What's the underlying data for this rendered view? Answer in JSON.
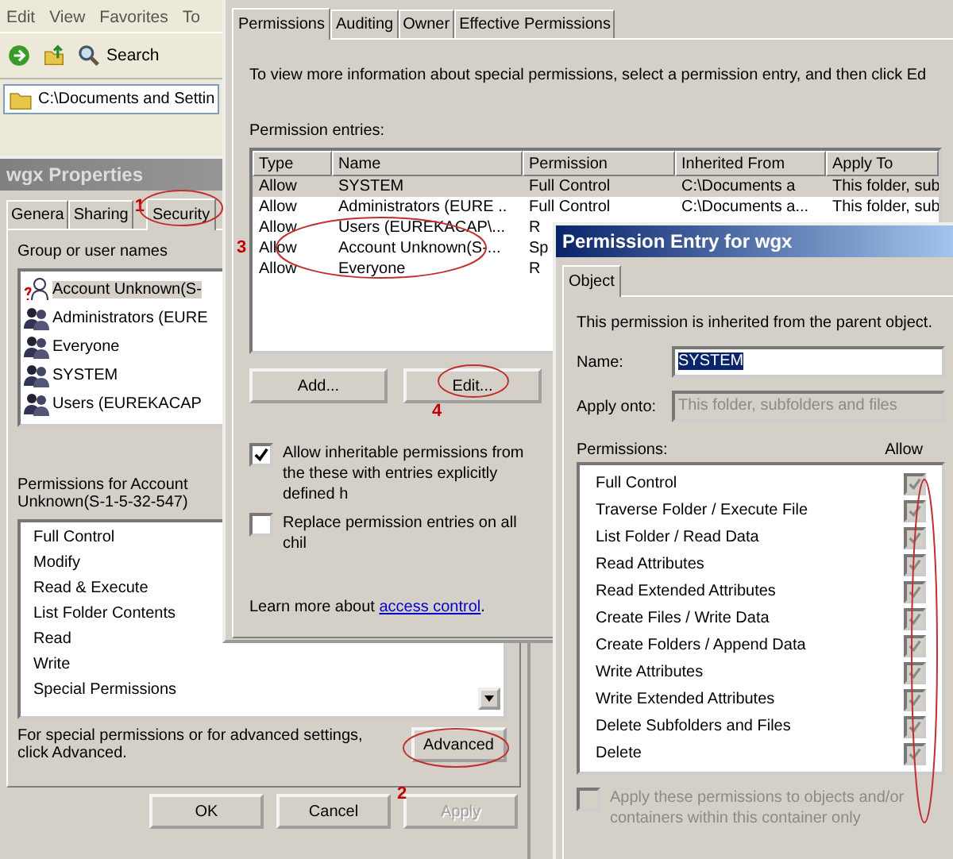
{
  "explorer": {
    "menu": [
      "Edit",
      "View",
      "Favorites",
      "To"
    ],
    "search": "Search",
    "address": "C:\\Documents and Settin"
  },
  "properties": {
    "title": "wgx Properties",
    "tabs": [
      {
        "label": "Genera",
        "selected": false
      },
      {
        "label": "Sharing",
        "selected": false
      },
      {
        "label": "Security",
        "selected": true
      }
    ],
    "group_label": "Group or user names",
    "users": [
      {
        "name": "Account Unknown(S-",
        "kind": "unknown",
        "selected": true
      },
      {
        "name": "Administrators (EURE",
        "kind": "group",
        "selected": false
      },
      {
        "name": "Everyone",
        "kind": "group",
        "selected": false
      },
      {
        "name": "SYSTEM",
        "kind": "group",
        "selected": false
      },
      {
        "name": "Users (EUREKACAP",
        "kind": "group",
        "selected": false
      }
    ],
    "perm_label": "Permissions for Account Unknown(S-1-5-32-547)",
    "permissions": [
      "Full Control",
      "Modify",
      "Read & Execute",
      "List Folder Contents",
      "Read",
      "Write",
      "Special Permissions"
    ],
    "advanced_note": "For special permissions or for advanced settings, click Advanced.",
    "advanced_button": "Advanced",
    "buttons": [
      {
        "label": "OK",
        "disabled": false
      },
      {
        "label": "Cancel",
        "disabled": false
      },
      {
        "label": "Apply",
        "disabled": true
      }
    ]
  },
  "advanced": {
    "tabs": [
      {
        "label": "Permissions",
        "selected": true
      },
      {
        "label": "Auditing",
        "selected": false
      },
      {
        "label": "Owner",
        "selected": false
      },
      {
        "label": "Effective Permissions",
        "selected": false
      }
    ],
    "intro": "To view more information about special permissions, select a permission entry, and then click Ed",
    "entries_label": "Permission entries:",
    "columns": [
      "Type",
      "Name",
      "Permission",
      "Inherited From",
      "Apply To"
    ],
    "rows": [
      {
        "type": "Allow",
        "name": "SYSTEM",
        "permission": "Full Control",
        "inherited": "C:\\Documents a",
        "apply": "This folder, sub",
        "selected": true
      },
      {
        "type": "Allow",
        "name": "Administrators (EURE ..",
        "permission": "Full Control",
        "inherited": "C:\\Documents a...",
        "apply": "This folder, sub",
        "selected": false
      },
      {
        "type": "Allow",
        "name": "Users (EUREKACAP\\...",
        "permission": "R",
        "selected": false
      },
      {
        "type": "Allow",
        "name": "Account Unknown(S-...",
        "permission": "Sp",
        "selected": false
      },
      {
        "type": "Allow",
        "name": "Everyone",
        "permission": "R",
        "selected": false
      }
    ],
    "buttons": [
      "Add...",
      "Edit..."
    ],
    "options": [
      {
        "label": "Allow inheritable permissions from the these with entries explicitly defined h",
        "checked": true
      },
      {
        "label": "Replace permission entries on all chil",
        "checked": false
      }
    ],
    "learn_prefix": "Learn more about",
    "learn_link": "access control",
    "learn_suffix": "."
  },
  "entry": {
    "title": "Permission Entry for wgx",
    "tabs": [
      {
        "label": "Object",
        "selected": true
      }
    ],
    "note": "This permission is inherited from the parent object.",
    "name_label": "Name:",
    "name_value": "SYSTEM",
    "apply_label": "Apply onto:",
    "apply_value": "This folder, subfolders and files",
    "apply_disabled": true,
    "perm_label": "Permissions:",
    "allow_header": "Allow",
    "locked": true,
    "permissions": [
      {
        "label": "Full Control",
        "allow": true
      },
      {
        "label": "Traverse Folder / Execute File",
        "allow": true
      },
      {
        "label": "List Folder / Read Data",
        "allow": true
      },
      {
        "label": "Read Attributes",
        "allow": true
      },
      {
        "label": "Read Extended Attributes",
        "allow": true
      },
      {
        "label": "Create Files / Write Data",
        "allow": true
      },
      {
        "label": "Create Folders / Append Data",
        "allow": true
      },
      {
        "label": "Write Attributes",
        "allow": true
      },
      {
        "label": "Write Extended Attributes",
        "allow": true
      },
      {
        "label": "Delete Subfolders and Files",
        "allow": true
      },
      {
        "label": "Delete",
        "allow": true
      }
    ],
    "container_only": {
      "label": "Apply these permissions to objects and/or containers within this container only",
      "checked": false,
      "disabled": true
    }
  },
  "annotation_numbers": [
    "1",
    "2",
    "3",
    "4"
  ]
}
